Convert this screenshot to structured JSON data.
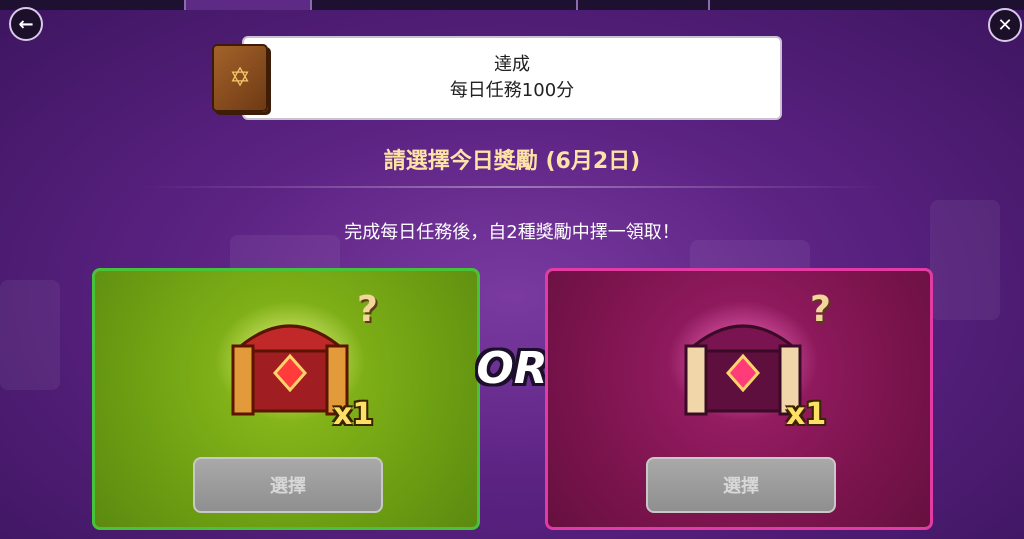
{
  "notice": {
    "line1": "達成",
    "line2": "每日任務100分"
  },
  "title": "請選擇今日獎勵 (6月2日)",
  "subtitle": "完成每日任務後，自2種獎勵中擇一領取！",
  "divider_label": "OR",
  "rewards": [
    {
      "count": "x1",
      "button_label": "選擇",
      "color": "#6ea013"
    },
    {
      "count": "x1",
      "button_label": "選擇",
      "color": "#7d144f"
    }
  ],
  "icons": {
    "back": "back-arrow-icon",
    "close": "close-icon",
    "book": "spellbook-icon",
    "chest": "treasure-chest-icon",
    "question": "question-mark-icon"
  }
}
